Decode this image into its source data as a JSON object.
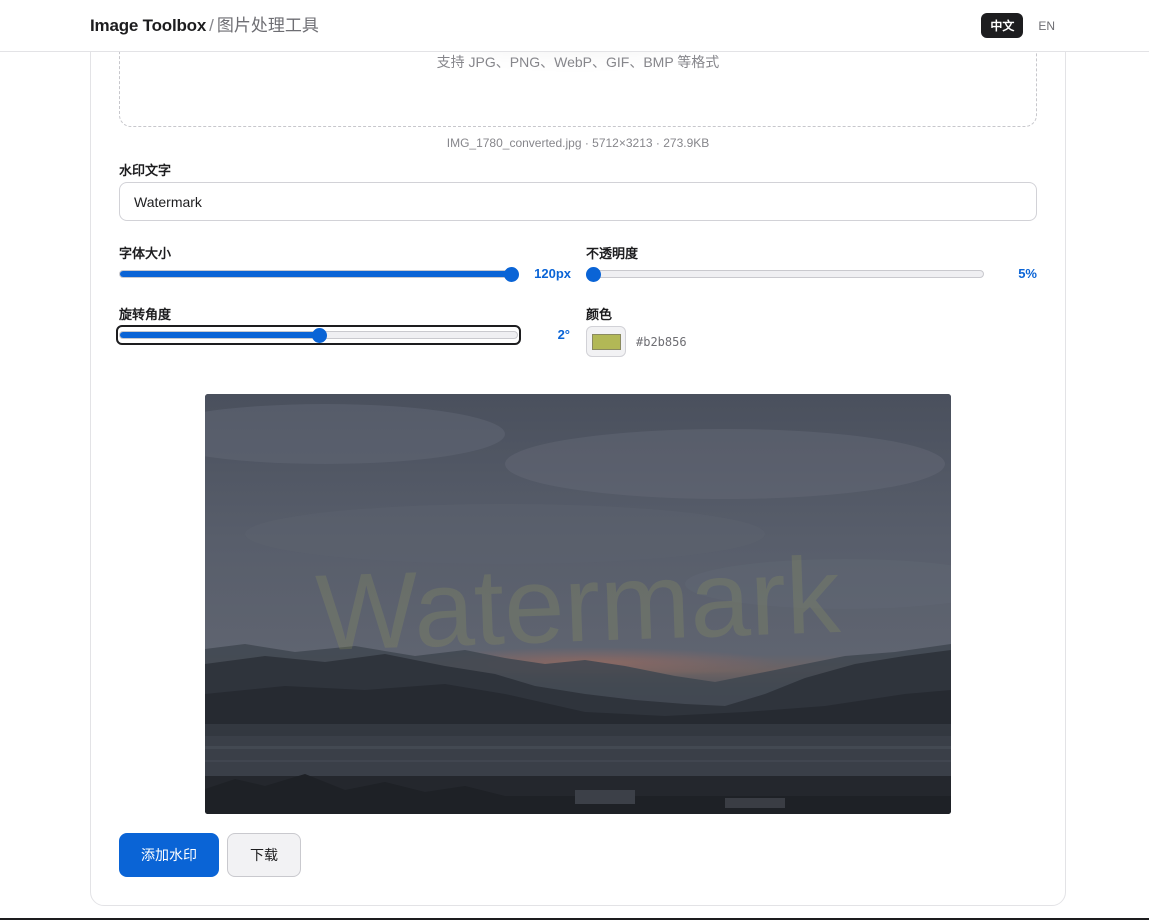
{
  "header": {
    "brand_main": "Image Toolbox",
    "brand_sep": "/",
    "brand_sub": "图片处理工具",
    "lang_zh": "中文",
    "lang_en": "EN",
    "active_lang": "zh"
  },
  "upload": {
    "hint": "支持 JPG、PNG、WebP、GIF、BMP 等格式",
    "file_info": "IMG_1780_converted.jpg · 5712×3213 · 273.9KB"
  },
  "form": {
    "text_label": "水印文字",
    "text_value": "Watermark",
    "font_size": {
      "label": "字体大小",
      "value_text": "120px",
      "level": 1.0
    },
    "opacity": {
      "label": "不透明度",
      "value_text": "5%",
      "level": 0.0
    },
    "rotation": {
      "label": "旋转角度",
      "value_text": "2°",
      "level": 0.5
    },
    "color": {
      "label": "颜色",
      "hex": "#b2b856"
    }
  },
  "preview": {
    "watermark_text": "Watermark",
    "watermark_color": "#b2b856"
  },
  "actions": {
    "apply_label": "添加水印",
    "download_label": "下载"
  },
  "colors": {
    "accent": "#0a64d6",
    "dark": "#1d1d1f"
  }
}
